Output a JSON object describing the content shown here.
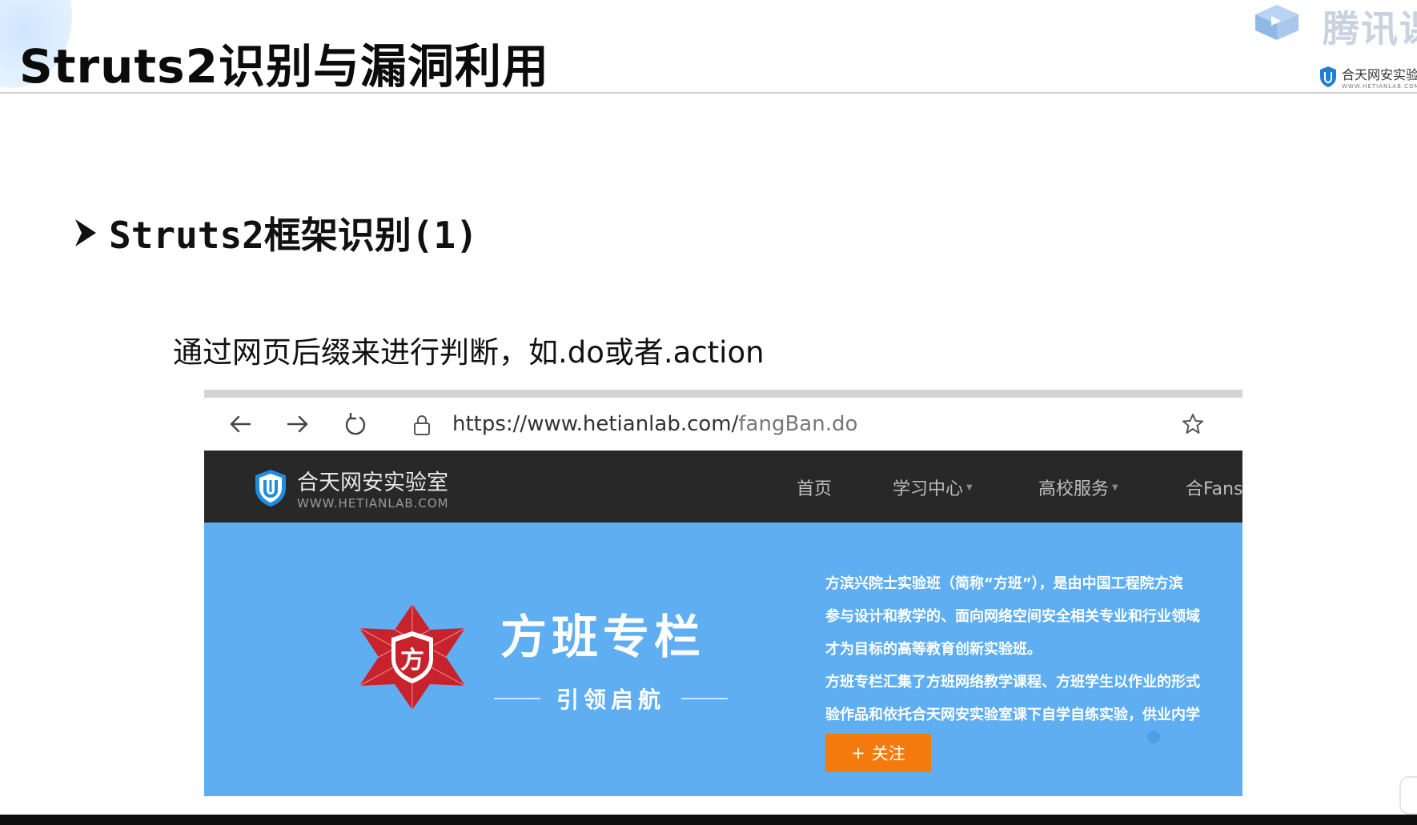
{
  "slide": {
    "title": "Struts2识别与漏洞利用",
    "section_heading": "Struts2框架识别(1)",
    "body_text": "通过网页后缀来进行判断，如.do或者.action"
  },
  "watermarks": {
    "tencent_text": "腾讯课",
    "hetian_text": "合天网安实验",
    "hetian_sub": "WWW.HETIANLAB.COM"
  },
  "browser": {
    "back_icon": "arrow-left-icon",
    "forward_icon": "arrow-right-icon",
    "refresh_icon": "refresh-icon",
    "lock_icon": "lock-icon",
    "url_host": "https://www.hetianlab.com/",
    "url_path": "fangBan.do",
    "bookmark_icon": "star-icon"
  },
  "site": {
    "logo_name": "合天网安实验室",
    "logo_sub": "WWW.HETIANLAB.COM",
    "nav": [
      {
        "label": "首页",
        "has_caret": false
      },
      {
        "label": "学习中心",
        "has_caret": true
      },
      {
        "label": "高校服务",
        "has_caret": true
      },
      {
        "label": "合Fans",
        "has_caret": false
      }
    ],
    "banner": {
      "title": "方班专栏",
      "subtitle": "引领启航",
      "description": [
        "方滨兴院士实验班（简称“方班”），是由中国工程院方滨",
        "参与设计和教学的、面向网络空间安全相关专业和行业领域",
        "才为目标的高等教育创新实验班。",
        "方班专栏汇集了方班网络教学课程、方班学生以作业的形式",
        "验作品和依托合天网安实验室课下自学自练实验，供业内学"
      ],
      "follow_label": "关注",
      "follow_icon": "plus-icon"
    }
  },
  "colors": {
    "nav_bg": "#282828",
    "banner_bg": "#5eaef1",
    "follow_button": "#f57a0e",
    "logo_red": "#c8232c"
  }
}
